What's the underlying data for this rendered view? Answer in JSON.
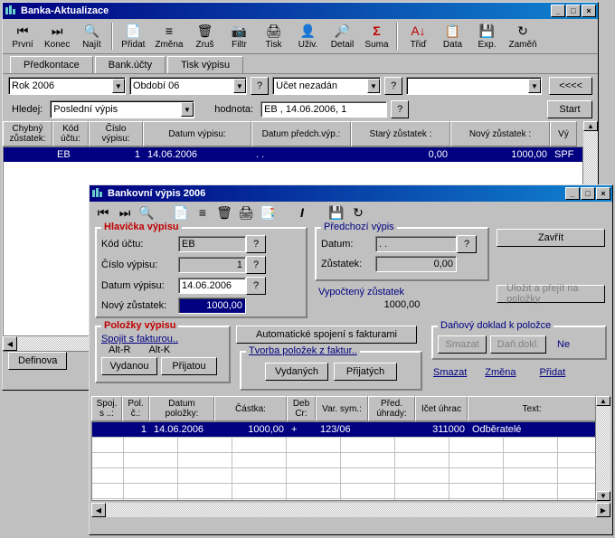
{
  "main_window": {
    "title": "Banka-Aktualizace",
    "toolbar": [
      {
        "icon": "⏮",
        "label": "První"
      },
      {
        "icon": "⏭",
        "label": "Konec"
      },
      {
        "icon": "🔍",
        "label": "Najít"
      },
      {
        "icon": "📄",
        "label": "Přidat"
      },
      {
        "icon": "≡",
        "label": "Změna"
      },
      {
        "icon": "🗑",
        "label": "Zruš"
      },
      {
        "icon": "📷",
        "label": "Filtr"
      },
      {
        "icon": "🖨",
        "label": "Tisk"
      },
      {
        "icon": "👤",
        "label": "Uživ."
      },
      {
        "icon": "🔎",
        "label": "Detail"
      },
      {
        "icon": "Σ",
        "label": "Suma"
      },
      {
        "icon": "A↓",
        "label": "Třiď"
      },
      {
        "icon": "📋",
        "label": "Data"
      },
      {
        "icon": "💾",
        "label": "Exp."
      },
      {
        "icon": "↻",
        "label": "Zaměň"
      }
    ],
    "tabs": [
      "Předkontace",
      "Bank.účty",
      "Tisk výpisu"
    ],
    "filters": {
      "rok": "Rok 2006",
      "obdobi": "Období 06",
      "ucet": "Účet nezadán",
      "back_label": "<<<<"
    },
    "search": {
      "hledej_label": "Hledej:",
      "hledej_value": "Poslední výpis",
      "hodnota_label": "hodnota:",
      "hodnota_value": "EB , 14.06.2006,   1",
      "start_label": "Start"
    },
    "grid_headers": [
      "Chybný zůstatek:",
      "Kód účtu:",
      "Číslo výpisu:",
      "Datum výpisu:",
      "Datum předch.výp.:",
      "Starý zůstatek :",
      "Nový zůstatek :",
      "Vý"
    ],
    "grid_row": [
      "",
      "EB",
      "1",
      "14.06.2006",
      ". .",
      "0,00",
      "1000,00",
      "SPF"
    ],
    "definovat_label": "Definova"
  },
  "child_window": {
    "title": "Bankovní výpis  2006",
    "hlavicka": {
      "title": "Hlavička výpisu",
      "kod_uctu_label": "Kód účtu:",
      "kod_uctu": "EB",
      "cislo_label": "Číslo výpisu:",
      "cislo": "1",
      "datum_label": "Datum výpisu:",
      "datum": "14.06.2006",
      "novy_label": "Nový zůstatek:",
      "novy": "1000,00"
    },
    "predchozi": {
      "title": "Předchozí výpis",
      "datum_label": "Datum:",
      "datum": ". .",
      "zustatek_label": "Zůstatek:",
      "zustatek": "0,00"
    },
    "vypocteny": {
      "label": "Vypočtený zůstatek",
      "value": "1000,00"
    },
    "zavrit_label": "Zavřít",
    "ulozit_label": "Uložit a přejít na položky",
    "polozky": {
      "title": "Položky výpisu",
      "auto_label": "Automatické spojení s fakturami",
      "spojit_label": "Spojit s fakturou..",
      "altr": "Alt-R",
      "altk": "Alt-K",
      "vydanou": "Vydanou",
      "prijatou": "Přijatou",
      "tvorba_label": "Tvorba položek z faktur..",
      "vydanych": "Vydaných",
      "prijatych": "Přijatých"
    },
    "danovy": {
      "title": "Daňový doklad k položce",
      "smazat": "Smazat",
      "dandokl": "Daň.dokl.",
      "ne": "Ne"
    },
    "actions": {
      "smazat": "Smazat",
      "zmena": "Změna",
      "pridat": "Přidat"
    },
    "grid_headers": [
      "Spoj. s ..:",
      "Pol. č.:",
      "Datum položky:",
      "Částka:",
      "Deb Cr:",
      "Var. sym.:",
      "Před. úhrady:",
      "Ičet úhrac",
      "Text:"
    ],
    "grid_row": [
      "",
      "1",
      "14.06.2006",
      "1000,00",
      "+",
      "123/06",
      "",
      "311000",
      "Odběratelé"
    ]
  }
}
